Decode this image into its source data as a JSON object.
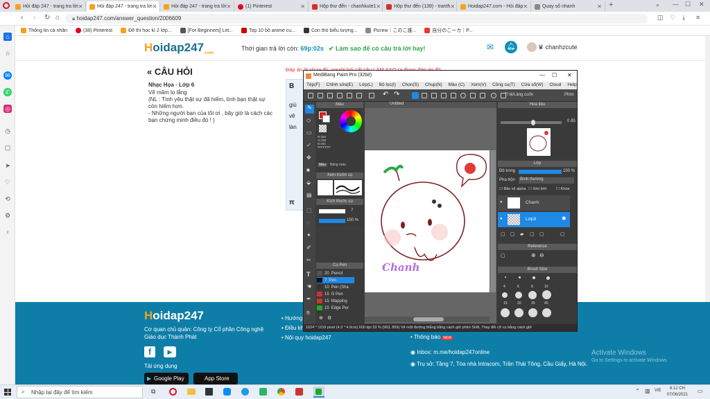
{
  "browser": {
    "tabs": [
      {
        "title": "Hỏi đáp 247 - trang tra lời",
        "color": "#f4a21b"
      },
      {
        "title": "Hỏi đáp 247 - trang tra lời",
        "color": "#f4a21b"
      },
      {
        "title": "Hỏi đáp 247 - trang tra lời",
        "color": "#f4a21b"
      },
      {
        "title": "(1) Pinterest",
        "color": "#e60023"
      },
      {
        "title": "Hộp thư đến - chanhkute1",
        "color": "#d93025"
      },
      {
        "title": "Hộp thư đến (139) - tranth",
        "color": "#d93025"
      },
      {
        "title": "Hoidap247.com - Hỏi đáp",
        "color": "#f4a21b"
      },
      {
        "title": "Quay số nhanh",
        "color": "#888888"
      }
    ],
    "address": "hoidap247.com/answer_question/2006609",
    "bookmarks": [
      {
        "label": "Thông tin cá nhân",
        "color": "#f4a21b"
      },
      {
        "label": "(38) Pinterest",
        "color": "#e60023"
      },
      {
        "label": "Đề thi học kì 2 lớp...",
        "color": "#f4a21b"
      },
      {
        "label": "[For Beginners] Let...",
        "color": "#555555"
      },
      {
        "label": "Top 10 bộ anime cu...",
        "color": "#cc0000"
      },
      {
        "label": "Con thỏ biểu tượng...",
        "color": "#333333"
      },
      {
        "label": "Picrew｜このこ誰...",
        "color": "#444444"
      },
      {
        "label": "自分のこーカ｜P...",
        "color": "#444444"
      }
    ]
  },
  "site": {
    "logo_main": "oidap247",
    "logo_h": "H",
    "logo_sub": ".com",
    "timer_label": "Thời gian trả lời còn:",
    "timer_value": "69p:02s",
    "howto": "Làm sao để có câu trả lời hay!",
    "username": "chanhzcute"
  },
  "question": {
    "heading": "CÂU HỎI",
    "subject": "Nhạc Họa · Lớp 6",
    "lines": [
      "Vẽ mầm lo lắng",
      "(NL : Tình yêu thật sự đã hiếm, tình bạn thật sự còn hiếm hơn.",
      "- Những người bạn của tôi ơi , bây giờ là cách các bạn chứng minh điều đó ! )"
    ],
    "hint": "Đáp án là chưa đủ, người hỏi cất câu LÀM SAO ra được đáp án đó",
    "editor_b": "B",
    "frag1": "giú",
    "frag2": "vẽ",
    "frag3": "làn",
    "frag4": "π"
  },
  "paint": {
    "title": "MediBang Paint Pro (32bit)",
    "menu": [
      "Tệp(F)",
      "Chỉnh sửa(E)",
      "Lớp(L)",
      "Bộ lọc(I)",
      "Chọn(S)",
      "Chụp(N)",
      "Màu (C)",
      "Xem(V)",
      "Công cụ(T)",
      "Cửa sổ(W)",
      "Cloud",
      "Help"
    ],
    "color_panel": "Màu",
    "color_values": [
      "R:255",
      "G:255",
      "B:255",
      "#FFFFFF"
    ],
    "color_tabs": [
      "Màu",
      "Bảng màu"
    ],
    "preview_panel": "Xem trước cọ",
    "size_panel": "Kích thước cọ",
    "size_value": "7",
    "opacity_value": "100 %",
    "brush_panel": "Cọ Pen",
    "brushes": [
      {
        "size": "20",
        "name": "Pencil",
        "color": "#555555"
      },
      {
        "size": "7",
        "name": "Pen",
        "color": "#1c6fd6"
      },
      {
        "size": "10",
        "name": "Pen (Sha",
        "color": "#333333"
      },
      {
        "size": "15",
        "name": "G Pen",
        "color": "#cc3333"
      },
      {
        "size": "15",
        "name": "Mapping",
        "color": "#cc3333"
      },
      {
        "size": "10",
        "name": "Edge Per",
        "color": "#22aa22"
      }
    ],
    "canvas_tab": "Untitled",
    "canvas_text": "Chanh",
    "status": "1024 * 1159 pixel  (4.3 * 4.9cm)  600 dpi  33 %  (993, 859)  Vẽ một đường thẳng bằng cách giữ phím Shift, Thay đổi cỡ cọ bằng cách giữ",
    "nav_panel": "Hoa tiêu",
    "nav_zoom": "0 độ",
    "layer_panel": "Lớp",
    "layer_opacity_label": "Độ trong",
    "layer_opacity": "100 %",
    "blend_label": "Pha trộn",
    "blend_value": "Bình thường",
    "layer_checks": [
      "Bảo vệ alpha",
      "Xén bớt",
      "Khóa"
    ],
    "layers": [
      {
        "name": "Chanh"
      },
      {
        "name": "Lớp3"
      }
    ],
    "ref_panel": "Reference",
    "brushsize_panel": "Brush Size",
    "brush_sizes": [
      "4",
      "6",
      "8",
      "10",
      "15",
      "20",
      "30",
      "40"
    ],
    "zoom_ratio": "Tỉ lệ/Lâng cuốn",
    "toolbar_right": "Phim"
  },
  "footer": {
    "logo": "oidap247",
    "company1": "Cơ quan chủ quản: Công ty Cổ phần Công nghệ",
    "company2": "Giáo dục Thành Phát",
    "app_label": "Tải ứng dụng",
    "gplay": "Google Play",
    "appstore": "App Store",
    "links": [
      "Hướng",
      "Điều kh",
      "Nội quy hoidap247"
    ],
    "notice": "Thông báo",
    "new_badge": "NEW",
    "inbox": "Inbox: m.me/hoidap247online",
    "address": "Trụ sở: Tầng 7, Tòa nhà Intracom, Trần Thái Tông, Cầu Giấy, Hà Nội.",
    "activate_title": "Activate Windows",
    "activate_sub": "Go to Settings to activate Windows."
  },
  "taskbar": {
    "search": "Nhập tại đây để tìm kiếm",
    "time": "8:12 CH",
    "date": "07/06/2021",
    "lang": "VIE"
  }
}
